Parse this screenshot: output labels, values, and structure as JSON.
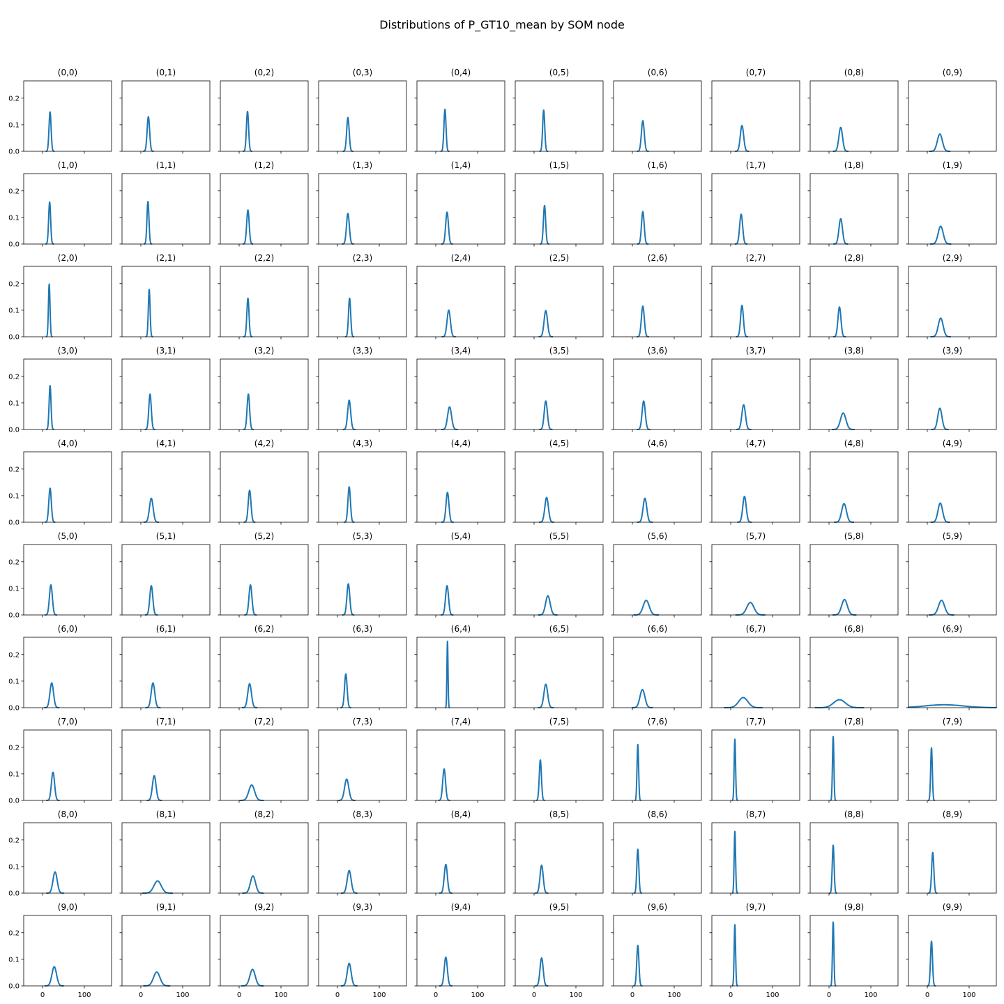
{
  "chart_data": {
    "type": "line",
    "title": "Distributions of P_GT10_mean by SOM node",
    "grid": false,
    "legend": "none",
    "line_color": "#1f77b4",
    "rows": 10,
    "cols": 10,
    "shared_xlim": [
      -45,
      165
    ],
    "shared_ylim": [
      0,
      0.265
    ],
    "x_ticks": [
      0,
      100
    ],
    "x_tick_labels": [
      "0",
      "100"
    ],
    "y_ticks": [
      0.0,
      0.1,
      0.2
    ],
    "y_tick_labels": [
      "0.0",
      "0.1",
      "0.2"
    ],
    "x_tick_labels_shown_on_row": 9,
    "y_tick_labels_shown_on_col": 0,
    "panels": [
      {
        "title": "(0,0)",
        "peak_x": 18,
        "peak_y": 0.148,
        "sigma": 2.5
      },
      {
        "title": "(0,1)",
        "peak_x": 18,
        "peak_y": 0.13,
        "sigma": 3
      },
      {
        "title": "(0,2)",
        "peak_x": 20,
        "peak_y": 0.15,
        "sigma": 2.6
      },
      {
        "title": "(0,3)",
        "peak_x": 25,
        "peak_y": 0.127,
        "sigma": 3
      },
      {
        "title": "(0,4)",
        "peak_x": 22,
        "peak_y": 0.158,
        "sigma": 2.5
      },
      {
        "title": "(0,5)",
        "peak_x": 23,
        "peak_y": 0.155,
        "sigma": 2.5
      },
      {
        "title": "(0,6)",
        "peak_x": 25,
        "peak_y": 0.115,
        "sigma": 3.4
      },
      {
        "title": "(0,7)",
        "peak_x": 27,
        "peak_y": 0.097,
        "sigma": 4
      },
      {
        "title": "(0,8)",
        "peak_x": 28,
        "peak_y": 0.09,
        "sigma": 4.4
      },
      {
        "title": "(0,9)",
        "peak_x": 30,
        "peak_y": 0.065,
        "sigma": 6
      },
      {
        "title": "(1,0)",
        "peak_x": 17,
        "peak_y": 0.158,
        "sigma": 2.4
      },
      {
        "title": "(1,1)",
        "peak_x": 17,
        "peak_y": 0.16,
        "sigma": 2.4
      },
      {
        "title": "(1,2)",
        "peak_x": 21,
        "peak_y": 0.128,
        "sigma": 3
      },
      {
        "title": "(1,3)",
        "peak_x": 25,
        "peak_y": 0.115,
        "sigma": 3.4
      },
      {
        "title": "(1,4)",
        "peak_x": 27,
        "peak_y": 0.12,
        "sigma": 3.3
      },
      {
        "title": "(1,5)",
        "peak_x": 25,
        "peak_y": 0.145,
        "sigma": 2.7
      },
      {
        "title": "(1,6)",
        "peak_x": 25,
        "peak_y": 0.122,
        "sigma": 3.2
      },
      {
        "title": "(1,7)",
        "peak_x": 25,
        "peak_y": 0.112,
        "sigma": 3.6
      },
      {
        "title": "(1,8)",
        "peak_x": 28,
        "peak_y": 0.095,
        "sigma": 4.2
      },
      {
        "title": "(1,9)",
        "peak_x": 32,
        "peak_y": 0.067,
        "sigma": 6
      },
      {
        "title": "(2,0)",
        "peak_x": 16,
        "peak_y": 0.198,
        "sigma": 1.9
      },
      {
        "title": "(2,1)",
        "peak_x": 20,
        "peak_y": 0.178,
        "sigma": 2.1
      },
      {
        "title": "(2,2)",
        "peak_x": 21,
        "peak_y": 0.145,
        "sigma": 2.6
      },
      {
        "title": "(2,3)",
        "peak_x": 29,
        "peak_y": 0.145,
        "sigma": 2.6
      },
      {
        "title": "(2,4)",
        "peak_x": 31,
        "peak_y": 0.1,
        "sigma": 4
      },
      {
        "title": "(2,5)",
        "peak_x": 28,
        "peak_y": 0.098,
        "sigma": 4.1
      },
      {
        "title": "(2,6)",
        "peak_x": 25,
        "peak_y": 0.115,
        "sigma": 3.5
      },
      {
        "title": "(2,7)",
        "peak_x": 27,
        "peak_y": 0.118,
        "sigma": 3.4
      },
      {
        "title": "(2,8)",
        "peak_x": 25,
        "peak_y": 0.112,
        "sigma": 3.6
      },
      {
        "title": "(2,9)",
        "peak_x": 32,
        "peak_y": 0.07,
        "sigma": 5.8
      },
      {
        "title": "(3,0)",
        "peak_x": 18,
        "peak_y": 0.165,
        "sigma": 2.3
      },
      {
        "title": "(3,1)",
        "peak_x": 22,
        "peak_y": 0.133,
        "sigma": 3
      },
      {
        "title": "(3,2)",
        "peak_x": 22,
        "peak_y": 0.133,
        "sigma": 3
      },
      {
        "title": "(3,3)",
        "peak_x": 28,
        "peak_y": 0.11,
        "sigma": 3.6
      },
      {
        "title": "(3,4)",
        "peak_x": 33,
        "peak_y": 0.085,
        "sigma": 4.7
      },
      {
        "title": "(3,5)",
        "peak_x": 28,
        "peak_y": 0.107,
        "sigma": 3.8
      },
      {
        "title": "(3,6)",
        "peak_x": 27,
        "peak_y": 0.107,
        "sigma": 3.8
      },
      {
        "title": "(3,7)",
        "peak_x": 31,
        "peak_y": 0.093,
        "sigma": 4.3
      },
      {
        "title": "(3,8)",
        "peak_x": 34,
        "peak_y": 0.062,
        "sigma": 6.5
      },
      {
        "title": "(3,9)",
        "peak_x": 30,
        "peak_y": 0.08,
        "sigma": 5
      },
      {
        "title": "(4,0)",
        "peak_x": 18,
        "peak_y": 0.128,
        "sigma": 3
      },
      {
        "title": "(4,1)",
        "peak_x": 25,
        "peak_y": 0.09,
        "sigma": 4.4
      },
      {
        "title": "(4,2)",
        "peak_x": 25,
        "peak_y": 0.12,
        "sigma": 3.3
      },
      {
        "title": "(4,3)",
        "peak_x": 28,
        "peak_y": 0.133,
        "sigma": 3
      },
      {
        "title": "(4,4)",
        "peak_x": 28,
        "peak_y": 0.112,
        "sigma": 3.5
      },
      {
        "title": "(4,5)",
        "peak_x": 30,
        "peak_y": 0.093,
        "sigma": 4.3
      },
      {
        "title": "(4,6)",
        "peak_x": 30,
        "peak_y": 0.09,
        "sigma": 4.4
      },
      {
        "title": "(4,7)",
        "peak_x": 33,
        "peak_y": 0.097,
        "sigma": 4.1
      },
      {
        "title": "(4,8)",
        "peak_x": 36,
        "peak_y": 0.07,
        "sigma": 5.7
      },
      {
        "title": "(4,9)",
        "peak_x": 31,
        "peak_y": 0.072,
        "sigma": 5.5
      },
      {
        "title": "(5,0)",
        "peak_x": 20,
        "peak_y": 0.113,
        "sigma": 3.5
      },
      {
        "title": "(5,1)",
        "peak_x": 25,
        "peak_y": 0.11,
        "sigma": 3.6
      },
      {
        "title": "(5,2)",
        "peak_x": 27,
        "peak_y": 0.113,
        "sigma": 3.5
      },
      {
        "title": "(5,3)",
        "peak_x": 26,
        "peak_y": 0.117,
        "sigma": 3.4
      },
      {
        "title": "(5,4)",
        "peak_x": 27,
        "peak_y": 0.11,
        "sigma": 3.6
      },
      {
        "title": "(5,5)",
        "peak_x": 33,
        "peak_y": 0.072,
        "sigma": 5.5
      },
      {
        "title": "(5,6)",
        "peak_x": 33,
        "peak_y": 0.055,
        "sigma": 7.2
      },
      {
        "title": "(5,7)",
        "peak_x": 47,
        "peak_y": 0.047,
        "sigma": 8.5
      },
      {
        "title": "(5,8)",
        "peak_x": 37,
        "peak_y": 0.058,
        "sigma": 6.8
      },
      {
        "title": "(5,9)",
        "peak_x": 34,
        "peak_y": 0.055,
        "sigma": 7.2
      },
      {
        "title": "(6,0)",
        "peak_x": 22,
        "peak_y": 0.093,
        "sigma": 4.3
      },
      {
        "title": "(6,1)",
        "peak_x": 29,
        "peak_y": 0.093,
        "sigma": 4.3
      },
      {
        "title": "(6,2)",
        "peak_x": 25,
        "peak_y": 0.09,
        "sigma": 4.4
      },
      {
        "title": "(6,3)",
        "peak_x": 20,
        "peak_y": 0.127,
        "sigma": 3.1
      },
      {
        "title": "(6,4)",
        "peak_x": 28,
        "peak_y": 0.25,
        "sigma": 1.3
      },
      {
        "title": "(6,5)",
        "peak_x": 28,
        "peak_y": 0.088,
        "sigma": 4.5
      },
      {
        "title": "(6,6)",
        "peak_x": 24,
        "peak_y": 0.068,
        "sigma": 5.9
      },
      {
        "title": "(6,7)",
        "peak_x": 30,
        "peak_y": 0.038,
        "sigma": 11
      },
      {
        "title": "(6,8)",
        "peak_x": 25,
        "peak_y": 0.03,
        "sigma": 14
      },
      {
        "title": "(6,9)",
        "peak_x": 40,
        "peak_y": 0.011,
        "sigma": 45
      },
      {
        "title": "(7,0)",
        "peak_x": 25,
        "peak_y": 0.106,
        "sigma": 3.8
      },
      {
        "title": "(7,1)",
        "peak_x": 32,
        "peak_y": 0.093,
        "sigma": 4.3
      },
      {
        "title": "(7,2)",
        "peak_x": 30,
        "peak_y": 0.058,
        "sigma": 6.9
      },
      {
        "title": "(7,3)",
        "peak_x": 22,
        "peak_y": 0.08,
        "sigma": 5
      },
      {
        "title": "(7,4)",
        "peak_x": 20,
        "peak_y": 0.118,
        "sigma": 3.4
      },
      {
        "title": "(7,5)",
        "peak_x": 15,
        "peak_y": 0.152,
        "sigma": 2.6
      },
      {
        "title": "(7,6)",
        "peak_x": 13,
        "peak_y": 0.21,
        "sigma": 1.9
      },
      {
        "title": "(7,7)",
        "peak_x": 10,
        "peak_y": 0.23,
        "sigma": 1.7
      },
      {
        "title": "(7,8)",
        "peak_x": 10,
        "peak_y": 0.24,
        "sigma": 1.7
      },
      {
        "title": "(7,9)",
        "peak_x": 10,
        "peak_y": 0.198,
        "sigma": 2
      },
      {
        "title": "(8,0)",
        "peak_x": 30,
        "peak_y": 0.08,
        "sigma": 5
      },
      {
        "title": "(8,1)",
        "peak_x": 40,
        "peak_y": 0.046,
        "sigma": 8.7
      },
      {
        "title": "(8,2)",
        "peak_x": 33,
        "peak_y": 0.065,
        "sigma": 6.1
      },
      {
        "title": "(8,3)",
        "peak_x": 28,
        "peak_y": 0.085,
        "sigma": 4.7
      },
      {
        "title": "(8,4)",
        "peak_x": 24,
        "peak_y": 0.108,
        "sigma": 3.7
      },
      {
        "title": "(8,5)",
        "peak_x": 18,
        "peak_y": 0.105,
        "sigma": 3.8
      },
      {
        "title": "(8,6)",
        "peak_x": 13,
        "peak_y": 0.165,
        "sigma": 2.4
      },
      {
        "title": "(8,7)",
        "peak_x": 10,
        "peak_y": 0.232,
        "sigma": 1.7
      },
      {
        "title": "(8,8)",
        "peak_x": 10,
        "peak_y": 0.18,
        "sigma": 2.2
      },
      {
        "title": "(8,9)",
        "peak_x": 13,
        "peak_y": 0.153,
        "sigma": 2.6
      },
      {
        "title": "(9,0)",
        "peak_x": 28,
        "peak_y": 0.072,
        "sigma": 5.5
      },
      {
        "title": "(9,1)",
        "peak_x": 38,
        "peak_y": 0.052,
        "sigma": 7.7
      },
      {
        "title": "(9,2)",
        "peak_x": 32,
        "peak_y": 0.062,
        "sigma": 6.4
      },
      {
        "title": "(9,3)",
        "peak_x": 28,
        "peak_y": 0.085,
        "sigma": 4.7
      },
      {
        "title": "(9,4)",
        "peak_x": 24,
        "peak_y": 0.108,
        "sigma": 3.7
      },
      {
        "title": "(9,5)",
        "peak_x": 18,
        "peak_y": 0.105,
        "sigma": 3.8
      },
      {
        "title": "(9,6)",
        "peak_x": 13,
        "peak_y": 0.152,
        "sigma": 2.6
      },
      {
        "title": "(9,7)",
        "peak_x": 10,
        "peak_y": 0.23,
        "sigma": 1.7
      },
      {
        "title": "(9,8)",
        "peak_x": 10,
        "peak_y": 0.24,
        "sigma": 1.7
      },
      {
        "title": "(9,9)",
        "peak_x": 10,
        "peak_y": 0.168,
        "sigma": 2.4
      }
    ]
  }
}
